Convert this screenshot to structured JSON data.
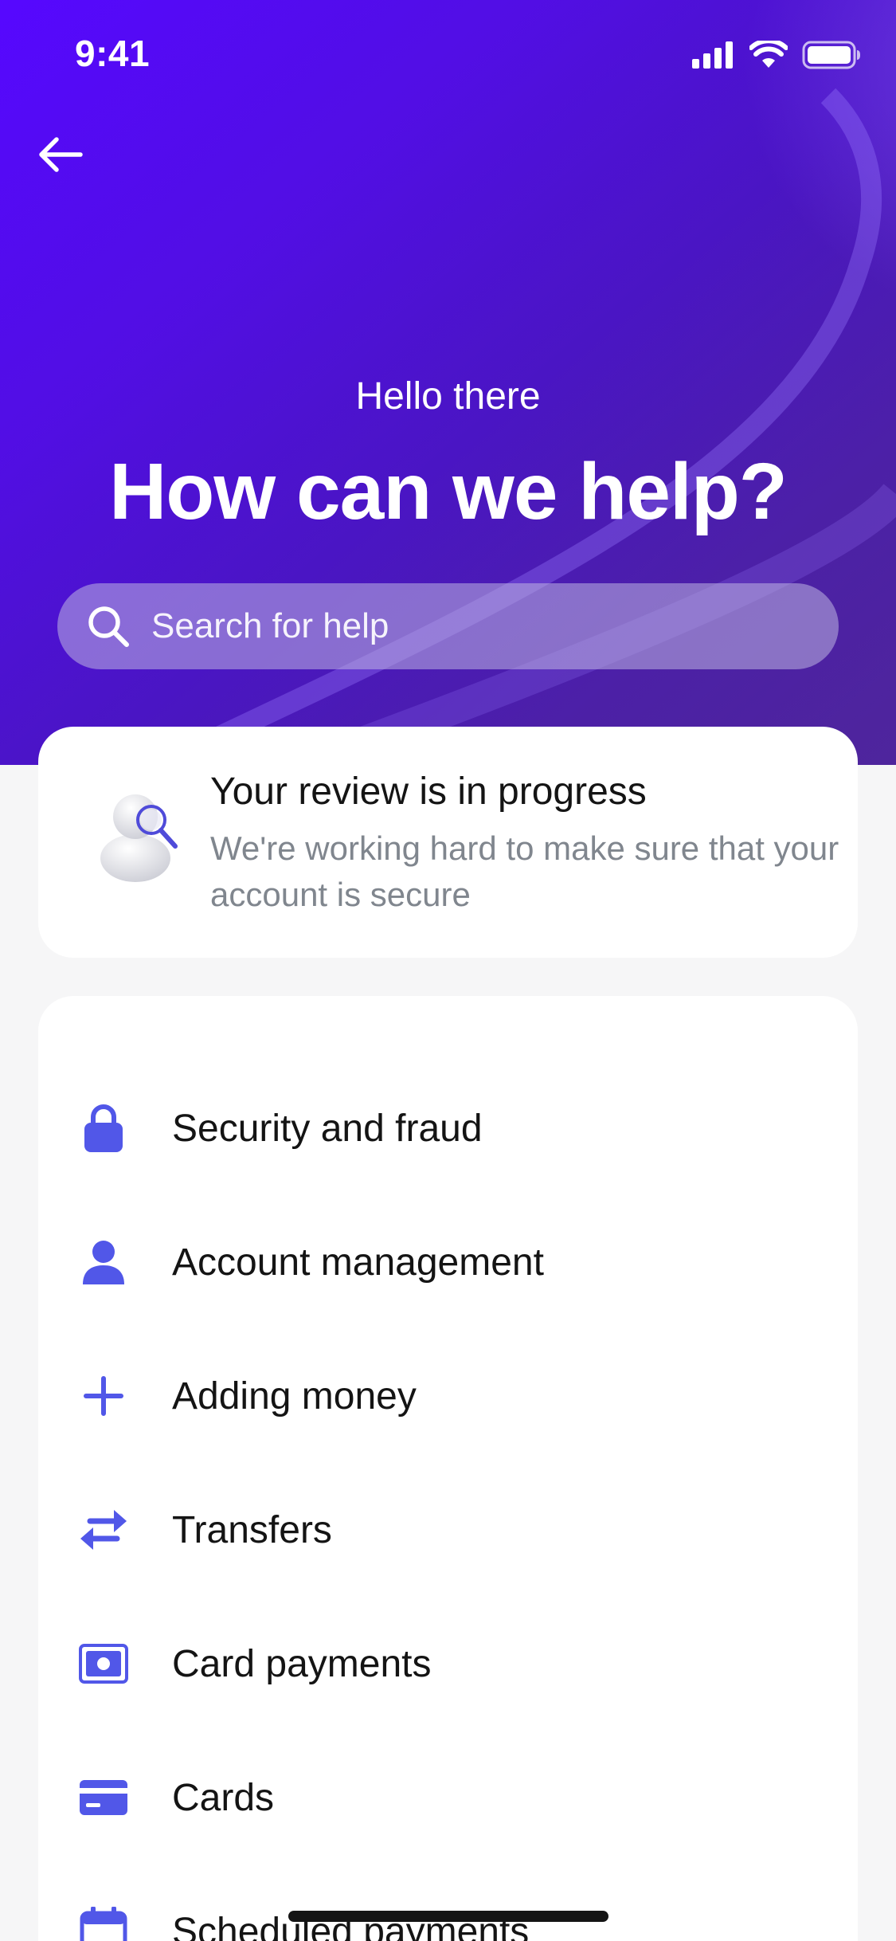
{
  "status_bar": {
    "time": "9:41"
  },
  "header": {
    "greeting": "Hello there",
    "headline": "How can we help?"
  },
  "search": {
    "placeholder": "Search for help",
    "value": ""
  },
  "review": {
    "title": "Your review is in progress",
    "description": "We're working hard to make sure that your account is secure"
  },
  "topics": [
    {
      "label": "Security and fraud",
      "icon": "lock-icon"
    },
    {
      "label": "Account management",
      "icon": "person-icon"
    },
    {
      "label": "Adding money",
      "icon": "plus-icon"
    },
    {
      "label": "Transfers",
      "icon": "transfer-arrows-icon"
    },
    {
      "label": "Card payments",
      "icon": "card-payment-icon"
    },
    {
      "label": "Cards",
      "icon": "card-icon"
    },
    {
      "label": "Scheduled payments",
      "icon": "calendar-icon"
    }
  ],
  "colors": {
    "accent": "#5157e8",
    "hero_start": "#5608ff",
    "hero_end": "#2b1d86",
    "text_primary": "#141414",
    "text_secondary": "#80868e"
  }
}
